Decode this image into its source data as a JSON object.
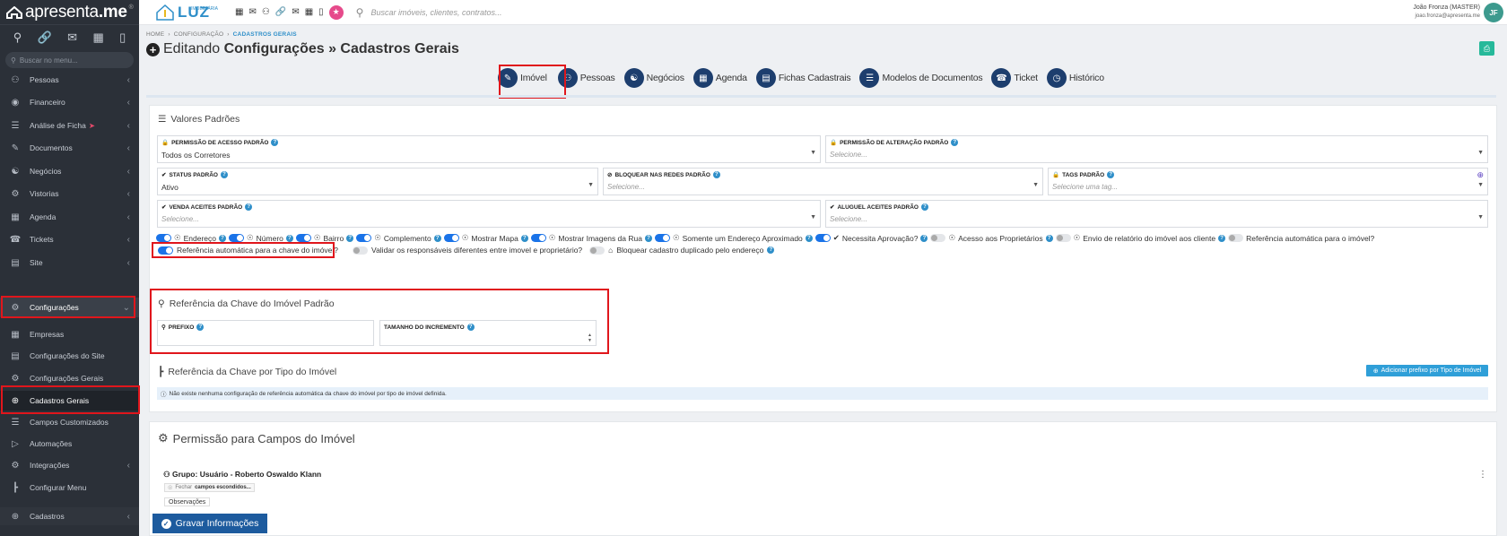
{
  "sidebar": {
    "brand": "apresenta",
    "brand_suffix": ".me",
    "search_placeholder": "Buscar no menu...",
    "items": [
      {
        "label": "Pessoas"
      },
      {
        "label": "Financeiro"
      },
      {
        "label": "Análise de Ficha"
      },
      {
        "label": "Documentos"
      },
      {
        "label": "Negócios"
      },
      {
        "label": "Vistorias"
      },
      {
        "label": "Agenda"
      },
      {
        "label": "Tickets"
      },
      {
        "label": "Site"
      },
      {
        "label": "Configurações"
      },
      {
        "label": "Empresas"
      },
      {
        "label": "Configurações do Site"
      },
      {
        "label": "Configurações Gerais"
      },
      {
        "label": "Cadastros Gerais"
      },
      {
        "label": "Campos Customizados"
      },
      {
        "label": "Automações"
      },
      {
        "label": "Integrações"
      },
      {
        "label": "Configurar Menu"
      },
      {
        "label": "Cadastros"
      }
    ]
  },
  "topbar": {
    "logo": "LUZ",
    "logo_pre": "IMOBILIÁRIA",
    "search_placeholder": "Buscar imóveis, clientes, contratos...",
    "user_name": "João Fronza (MASTER)",
    "user_email": "joao.fronza@apresenta.me",
    "avatar": "JF"
  },
  "breadcrumb": {
    "home": "HOME",
    "config": "CONFIGURAÇÃO",
    "current": "CADASTROS GERAIS"
  },
  "page": {
    "title_pre": "Editando",
    "title": "Configurações » Cadastros Gerais"
  },
  "tabs": [
    "Imóvel",
    "Pessoas",
    "Negócios",
    "Agenda",
    "Fichas Cadastrais",
    "Modelos de Documentos",
    "Ticket",
    "Histórico"
  ],
  "valores": {
    "title": "Valores Padrões",
    "permissao_acesso": {
      "label": "PERMISSÃO DE ACESSO PADRÃO",
      "value": "Todos os Corretores"
    },
    "permissao_alteracao": {
      "label": "PERMISSÃO DE ALTERAÇÃO PADRÃO",
      "placeholder": "Selecione..."
    },
    "status": {
      "label": "STATUS PADRÃO",
      "value": "Ativo"
    },
    "bloquear": {
      "label": "BLOQUEAR NAS REDES PADRÃO",
      "placeholder": "Selecione..."
    },
    "tags": {
      "label": "TAGS PADRÃO",
      "placeholder": "Selecione uma tag..."
    },
    "venda": {
      "label": "VENDA ACEITES PADRÃO",
      "placeholder": "Selecione..."
    },
    "aluguel": {
      "label": "ALUGUEL ACEITES PADRÃO",
      "placeholder": "Selecione..."
    }
  },
  "toggles_row1": [
    {
      "label": "Endereço",
      "on": true,
      "eye": true
    },
    {
      "label": "Número",
      "on": true,
      "eye": true
    },
    {
      "label": "Bairro",
      "on": true,
      "eye": true
    },
    {
      "label": "Complemento",
      "on": true,
      "eye": true
    },
    {
      "label": "Mostrar Mapa",
      "on": true,
      "eye": true
    },
    {
      "label": "Mostrar Imagens da Rua",
      "on": true,
      "eye": true
    },
    {
      "label": "Somente um Endereço Aproximado",
      "on": true,
      "eye": true
    },
    {
      "label": "Necessita Aprovação?",
      "on": true,
      "eye": false
    },
    {
      "label": "Acesso aos Proprietários",
      "on": false,
      "eye": true
    },
    {
      "label": "Envio de relatório do imóvel aos cliente",
      "on": false,
      "eye": true
    },
    {
      "label": "Referência automática para o imóvel?",
      "on": false,
      "eye": false
    }
  ],
  "toggles_row2": [
    {
      "label": "Referência automática para a chave do imóvel?",
      "on": true
    },
    {
      "label": "Validar os responsáveis diferentes entre imovel e proprietário?",
      "on": false
    },
    {
      "label": "Bloquear cadastro duplicado pelo endereço",
      "on": false
    }
  ],
  "chave": {
    "title": "Referência da Chave do Imóvel Padrão",
    "prefixo": "PREFIXO",
    "tamanho": "TAMANHO DO INCREMENTO"
  },
  "chave_tipo": {
    "title": "Referência da Chave por Tipo do Imóvel",
    "add_button": "Adicionar prefixo por Tipo de Imóvel",
    "info": "Não existe nenhuma configuração de referência automática da chave do imóvel por tipo de imóvel definida."
  },
  "permissao": {
    "title": "Permissão para Campos do Imóvel",
    "group": "Grupo: Usuário - Roberto Oswaldo Klann",
    "chip_close": "Fechar",
    "chip_text": "campos escondidos...",
    "field": "Observações"
  },
  "save_label": "Gravar Informações"
}
